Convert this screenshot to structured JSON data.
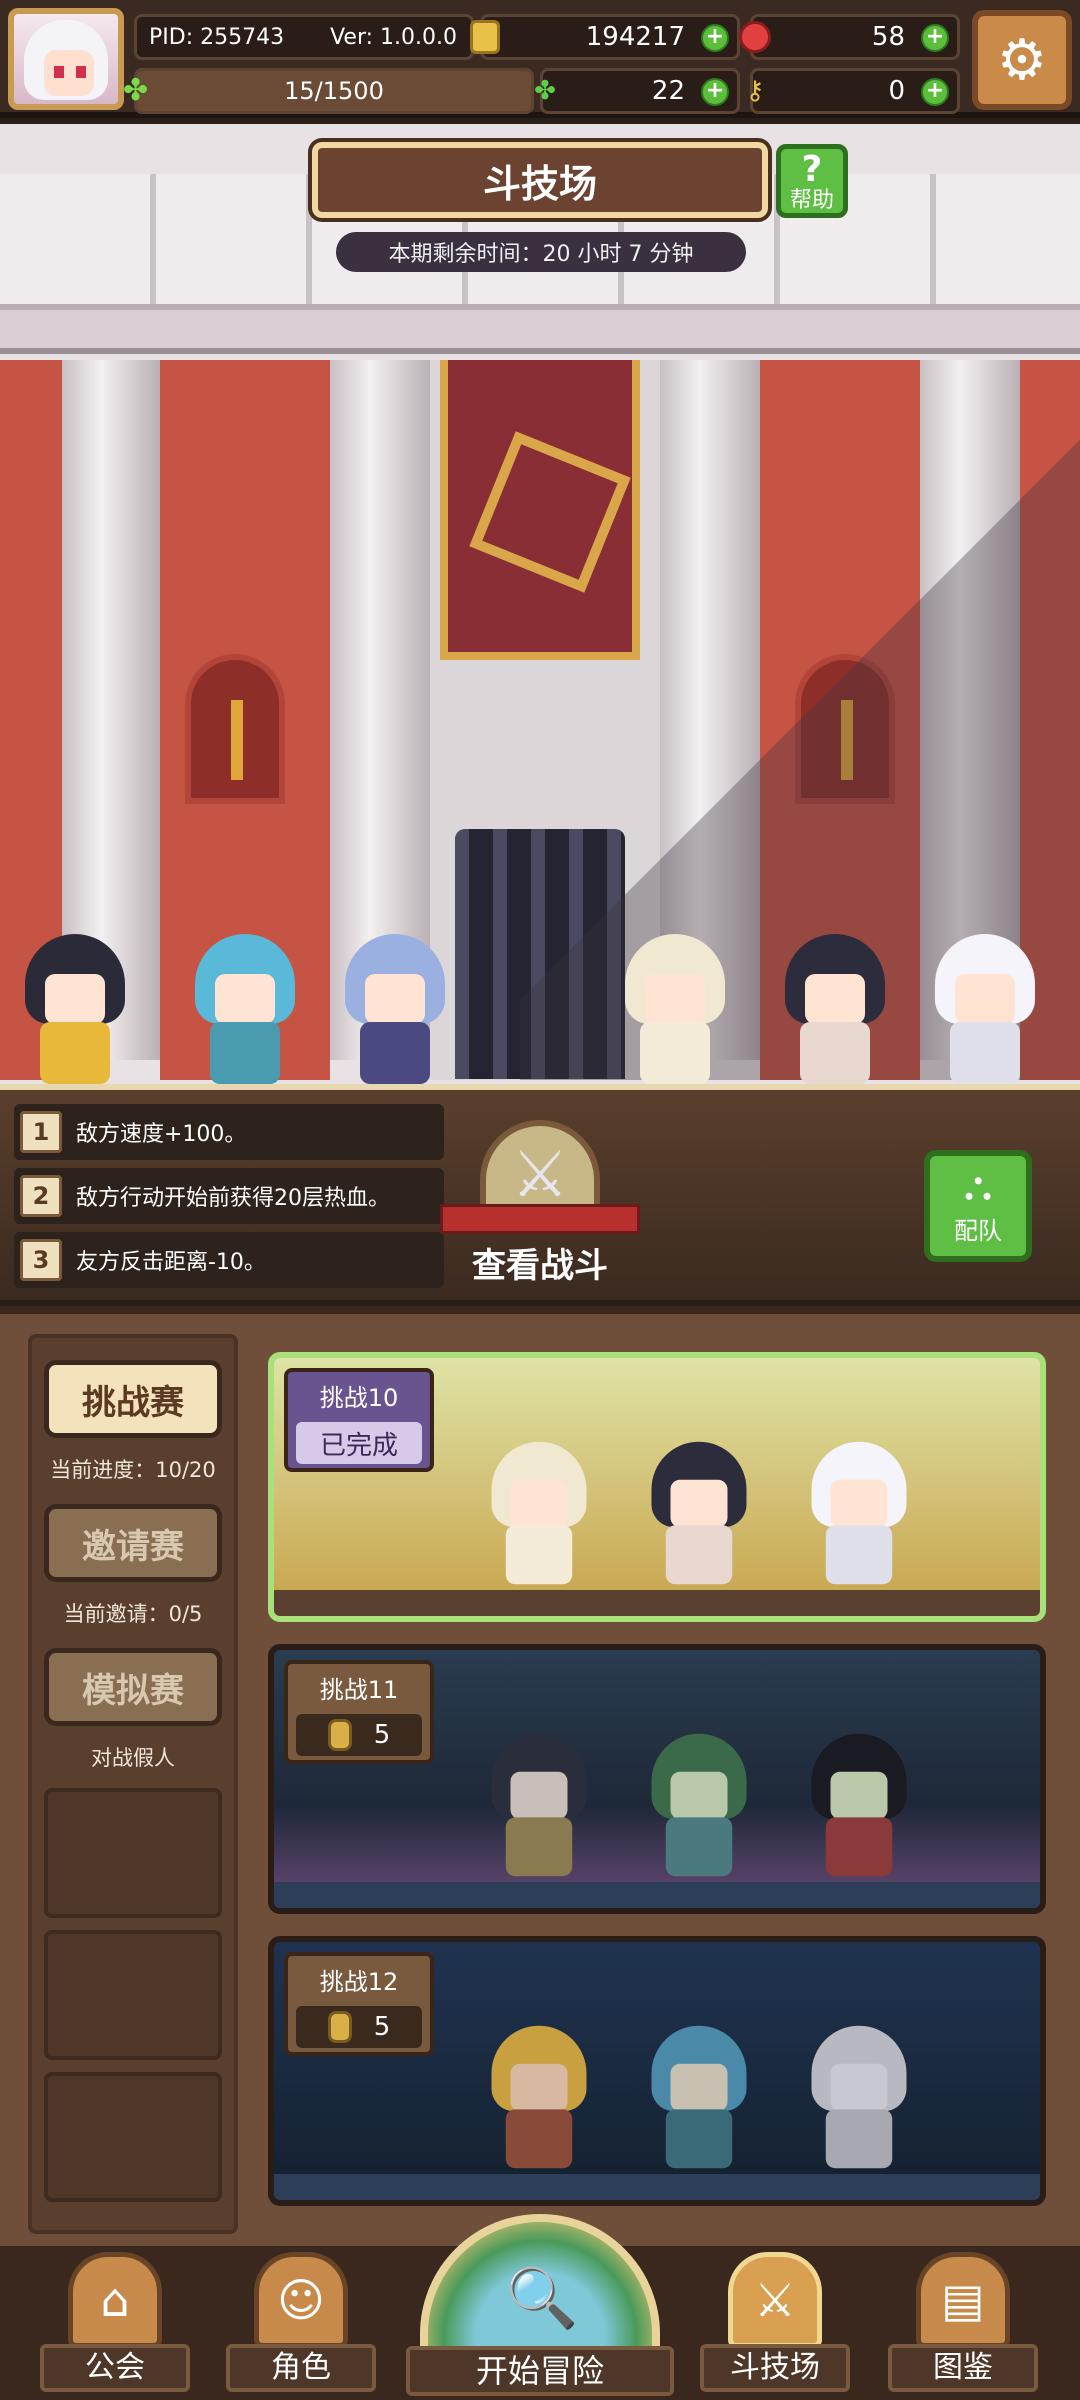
{
  "status_bar": {
    "pid": "PID: 255743",
    "version": "Ver: 1.0.0.0",
    "energy": "15/1500",
    "gold": "194217",
    "gems": "58",
    "clovers": "22",
    "keys": "0",
    "plus": "+"
  },
  "arena": {
    "title": "斗技场",
    "help_label": "帮助",
    "help_glyph": "?",
    "timer": "本期剩余时间：20 小时 7 分钟"
  },
  "modifiers": [
    {
      "num": "1",
      "text": "敌方速度+100。"
    },
    {
      "num": "2",
      "text": "敌方行动开始前获得20层热血。"
    },
    {
      "num": "3",
      "text": "友方反击距离-10。"
    }
  ],
  "battle": {
    "view_label": "查看战斗",
    "team_label": "配队"
  },
  "modes": [
    {
      "label": "挑战赛",
      "sub": "当前进度：10/20",
      "active": true
    },
    {
      "label": "邀请赛",
      "sub": "当前邀请：0/5",
      "active": false
    },
    {
      "label": "模拟赛",
      "sub": "对战假人",
      "active": false
    }
  ],
  "challenges": [
    {
      "name": "挑战10",
      "status": "已完成"
    },
    {
      "name": "挑战11",
      "cost": "5"
    },
    {
      "name": "挑战12",
      "cost": "5"
    }
  ],
  "nav": {
    "guild": "公会",
    "character": "角色",
    "adventure": "开始冒险",
    "arena": "斗技场",
    "codex": "图鉴"
  },
  "icons": {
    "settings": "gear-icon",
    "energy": "clover-energy-icon",
    "gold": "coin-icon",
    "gems": "ruby-icon",
    "clovers": "clover-icon",
    "keys": "key-icon"
  },
  "colors": {
    "plus_green": "#5bbf3c",
    "active_card_border": "#a8e07a",
    "banner_red": "#8a2e36",
    "wall_red": "#c65444"
  }
}
